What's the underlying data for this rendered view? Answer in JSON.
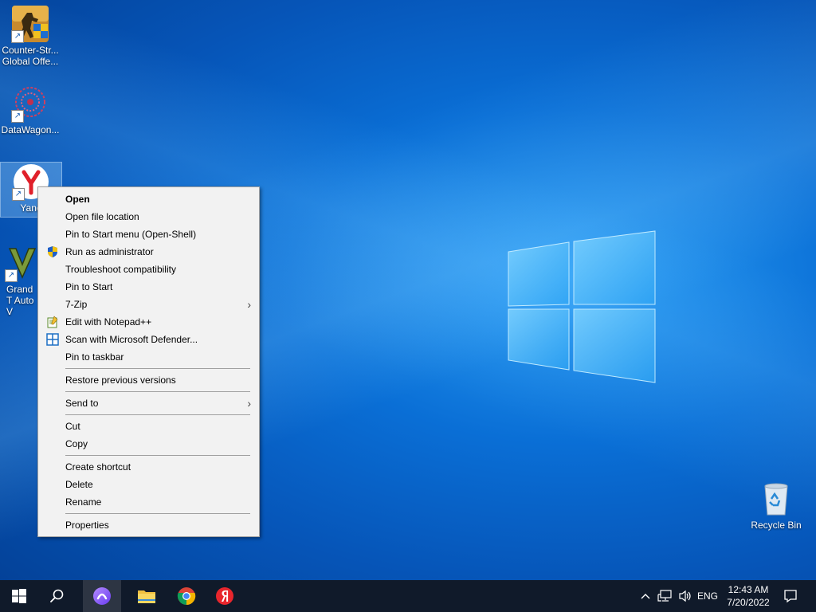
{
  "desktop": {
    "icons": [
      {
        "label": "Counter-Str... Global Offe..."
      },
      {
        "label": "DataWagon..."
      },
      {
        "label": "Yand"
      },
      {
        "label": "Grand T Auto V"
      },
      {
        "label": "Recycle Bin"
      }
    ]
  },
  "context_menu": {
    "items": [
      {
        "label": "Open"
      },
      {
        "label": "Open file location"
      },
      {
        "label": "Pin to Start menu (Open-Shell)"
      },
      {
        "label": "Run as administrator"
      },
      {
        "label": "Troubleshoot compatibility"
      },
      {
        "label": "Pin to Start"
      },
      {
        "label": "7-Zip"
      },
      {
        "label": "Edit with Notepad++"
      },
      {
        "label": "Scan with Microsoft Defender..."
      },
      {
        "label": "Pin to taskbar"
      },
      {
        "label": "Restore previous versions"
      },
      {
        "label": "Send to"
      },
      {
        "label": "Cut"
      },
      {
        "label": "Copy"
      },
      {
        "label": "Create shortcut"
      },
      {
        "label": "Delete"
      },
      {
        "label": "Rename"
      },
      {
        "label": "Properties"
      }
    ]
  },
  "taskbar": {
    "language": "ENG",
    "time": "12:43 AM",
    "date": "7/20/2022"
  }
}
